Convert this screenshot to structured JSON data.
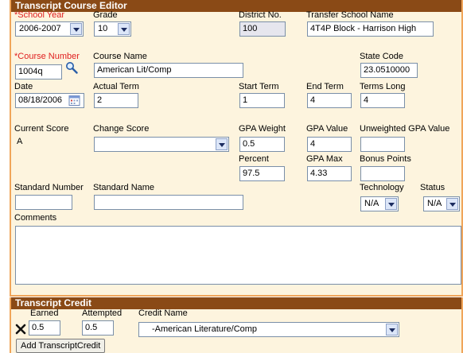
{
  "editor": {
    "title": "Transcript Course Editor",
    "school_year": {
      "label": "*School Year",
      "value": "2006-2007"
    },
    "grade": {
      "label": "Grade",
      "value": "10"
    },
    "district_no": {
      "label": "District No.",
      "value": "100"
    },
    "transfer_school": {
      "label": "Transfer School Name",
      "value": "4T4P Block - Harrison High"
    },
    "course_number": {
      "label": "*Course Number",
      "value": "1004q"
    },
    "course_name": {
      "label": "Course Name",
      "value": "American Lit/Comp"
    },
    "state_code": {
      "label": "State Code",
      "value": "23.0510000"
    },
    "date": {
      "label": "Date",
      "value": "08/18/2006"
    },
    "actual_term": {
      "label": "Actual Term",
      "value": "2"
    },
    "start_term": {
      "label": "Start Term",
      "value": "1"
    },
    "end_term": {
      "label": "End Term",
      "value": "4"
    },
    "terms_long": {
      "label": "Terms Long",
      "value": "4"
    },
    "current_score": {
      "label": "Current Score",
      "value": "A"
    },
    "change_score": {
      "label": "Change Score",
      "value": ""
    },
    "gpa_weight": {
      "label": "GPA Weight",
      "value": "0.5"
    },
    "gpa_value": {
      "label": "GPA Value",
      "value": "4"
    },
    "unweighted_gpa": {
      "label": "Unweighted GPA Value",
      "value": ""
    },
    "percent": {
      "label": "Percent",
      "value": "97.5"
    },
    "gpa_max": {
      "label": "GPA Max",
      "value": "4.33"
    },
    "bonus_points": {
      "label": "Bonus Points",
      "value": ""
    },
    "standard_number": {
      "label": "Standard Number",
      "value": ""
    },
    "standard_name": {
      "label": "Standard Name",
      "value": ""
    },
    "technology": {
      "label": "Technology",
      "value": "N/A"
    },
    "status": {
      "label": "Status",
      "value": "N/A"
    },
    "comments": {
      "label": "Comments",
      "value": ""
    }
  },
  "credit": {
    "title": "Transcript Credit",
    "earned_label": "Earned",
    "attempted_label": "Attempted",
    "credit_name_label": "Credit Name",
    "earned": "0.5",
    "attempted": "0.5",
    "credit_name": "-American Literature/Comp",
    "add_button": "Add TranscriptCredit"
  },
  "icons": {
    "search": "magnifier-icon",
    "calendar": "calendar-icon",
    "delete": "delete-x-icon"
  },
  "colors": {
    "header_bg": "#8a4a16",
    "panel_border": "#f0a55a",
    "panel_bg": "#fdf4de",
    "required": "#e02020"
  }
}
